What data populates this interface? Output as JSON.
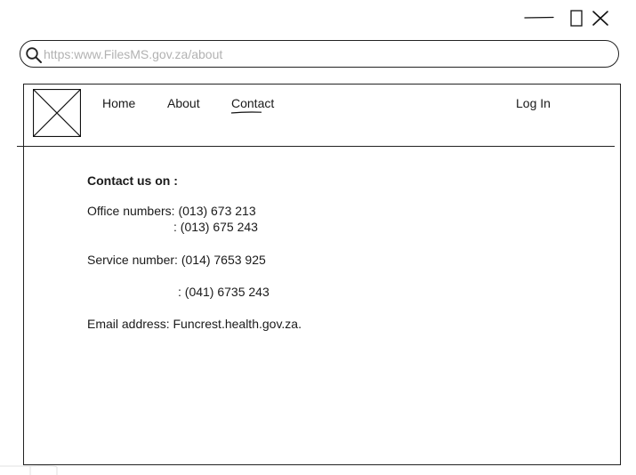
{
  "window": {
    "controls": {
      "minimize_icon": "minimize-icon",
      "maximize_icon": "maximize-icon",
      "close_icon": "close-icon"
    }
  },
  "address_bar": {
    "placeholder": "https:www.FilesMS.gov.za/about",
    "value": "",
    "icon": "search-icon"
  },
  "header": {
    "logo_icon": "image-placeholder-icon",
    "nav": {
      "home": "Home",
      "about": "About",
      "contact": "Contact",
      "login": "Log In"
    },
    "active_item": "Contact"
  },
  "contact": {
    "heading": "Contact us on :",
    "office_label": "Office numbers:",
    "office_number_1": "(013) 673 213",
    "office_number_2": ": (013) 675 243",
    "service_label": "Service number:",
    "service_number_1": "(014) 7653 925",
    "service_number_2": ": (041) 6735 243",
    "email_label": "Email address:",
    "email_value": "Funcrest.health.gov.za."
  }
}
